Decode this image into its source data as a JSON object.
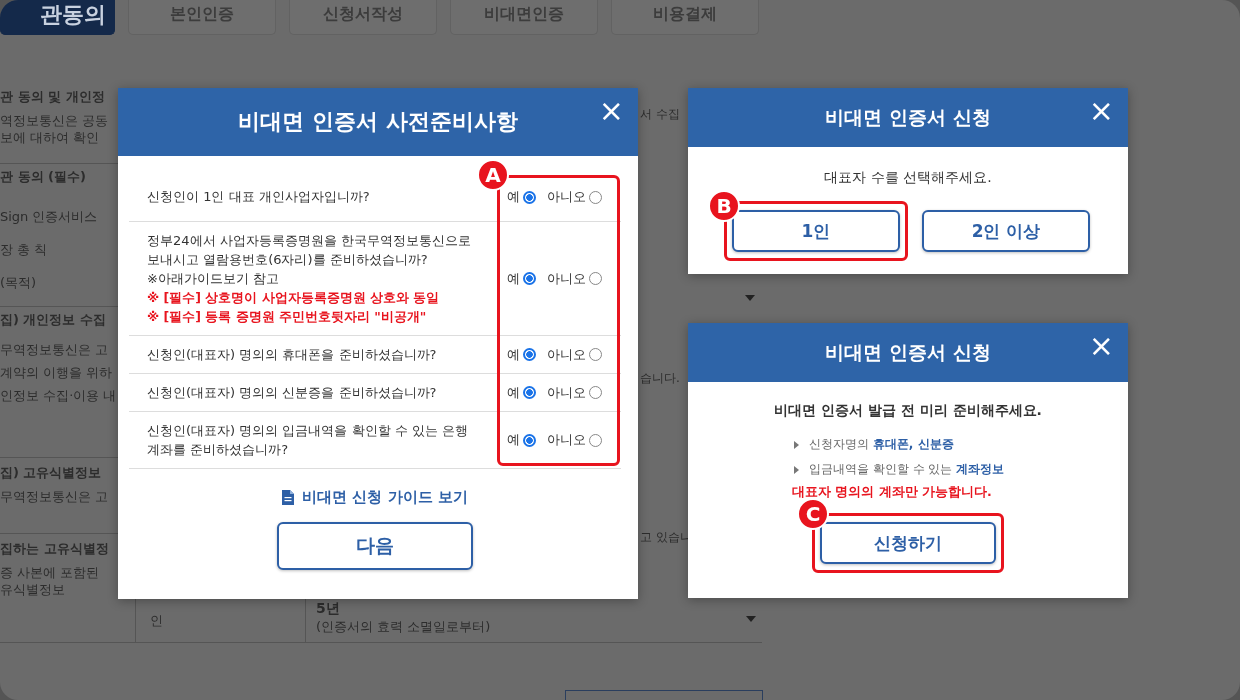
{
  "background": {
    "tabs": [
      {
        "label": "관동의",
        "selected": true
      },
      {
        "label": "본인인증",
        "selected": false
      },
      {
        "label": "신청서작성",
        "selected": false
      },
      {
        "label": "비대면인증",
        "selected": false
      },
      {
        "label": "비용결제",
        "selected": false
      }
    ],
    "sections": [
      {
        "title": "관 동의 및 개인정",
        "lines": [
          "역정보통신은 공동",
          "보에 대하여 확인"
        ]
      },
      {
        "title": "관 동의 (필수)",
        "lines": [
          "Sign 인증서비스",
          "장 총 칙",
          "(목적)"
        ]
      },
      {
        "title": "집) 개인정보 수집",
        "lines": [
          "무역정보통신은 고",
          "계약의 이행을 위하",
          "인정보 수집·이용 내"
        ]
      },
      {
        "title": "집) 고유식별정보",
        "lines": [
          "무역정보통신은 고"
        ]
      },
      {
        "title": "집하는 고유식별정",
        "lines": [
          "증 사본에 포함된",
          "유식별정보"
        ]
      }
    ],
    "right_fragments": [
      "서 수집",
      "습니다.",
      "고 있습니"
    ],
    "table_row": {
      "column_2": "인",
      "column_3": [
        "5년",
        "(인증서의 효력 소멸일로부터)"
      ]
    }
  },
  "prep_dialog": {
    "title": "비대면 인증서 사전준비사항",
    "close": "×",
    "callout": "A",
    "questions": [
      {
        "text": "신청인이 1인 대표 개인사업자입니까?",
        "options": [
          {
            "label": "예",
            "selected": true
          },
          {
            "label": "아니오",
            "selected": false
          }
        ]
      },
      {
        "text": "정부24에서 사업자등록증명원을 한국무역정보통신으로 보내시고 열람용번호(6자리)를 준비하셨습니까?",
        "hint": "※아래가이드보기 참고",
        "notes": [
          "※ [필수] 상호명이 사업자등록증명원 상호와 동일",
          "※ [필수] 등록 증명원 주민번호뒷자리 \"비공개\""
        ],
        "options": [
          {
            "label": "예",
            "selected": true
          },
          {
            "label": "아니오",
            "selected": false
          }
        ]
      },
      {
        "text": "신청인(대표자) 명의의 휴대폰을 준비하셨습니까?",
        "options": [
          {
            "label": "예",
            "selected": true
          },
          {
            "label": "아니오",
            "selected": false
          }
        ]
      },
      {
        "text": "신청인(대표자) 명의의 신분증을 준비하셨습니까?",
        "options": [
          {
            "label": "예",
            "selected": true
          },
          {
            "label": "아니오",
            "selected": false
          }
        ]
      },
      {
        "text": "신청인(대표자) 명의의 입금내역을 확인할 수 있는 은행 계좌를 준비하셨습니까?",
        "options": [
          {
            "label": "예",
            "selected": true
          },
          {
            "label": "아니오",
            "selected": false
          }
        ]
      }
    ],
    "guide_link": "비대면 신청 가이드 보기",
    "next_button": "다음"
  },
  "count_dialog": {
    "title": "비대면 인증서 신청",
    "close": "×",
    "prompt": "대표자 수를 선택해주세요.",
    "callout": "B",
    "buttons": [
      "1인",
      "2인 이상"
    ]
  },
  "apply_dialog": {
    "title": "비대면 인증서 신청",
    "close": "×",
    "heading": "비대면 인증서 발급 전 미리 준비해주세요.",
    "bullets": [
      "신청자명의 **휴대폰, 신분증**",
      "입금내역을 확인할 수 있는 **계좌정보**"
    ],
    "warning": "대표자 명의의 계좌만 가능합니다.",
    "callout": "C",
    "apply_button": "신청하기"
  }
}
